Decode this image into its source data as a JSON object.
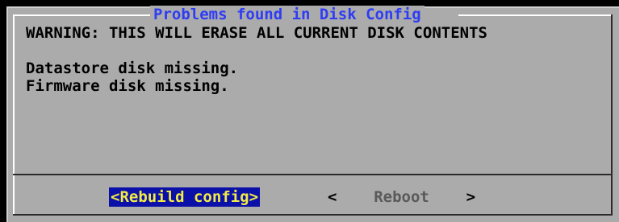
{
  "dialog": {
    "title": "Problems found in Disk Config",
    "warning": "WARNING: THIS WILL ERASE ALL CURRENT DISK CONTENTS",
    "messages": [
      "Datastore disk missing.",
      "Firmware disk missing."
    ]
  },
  "buttons": {
    "primary": "<Rebuild config>",
    "secondary_left_bracket": "<",
    "secondary_label": "Reboot",
    "secondary_right_bracket": ">"
  },
  "colors": {
    "dialog_background": "#ababab",
    "title_text": "#2e3cf4",
    "selected_button_background": "#0a10a8",
    "selected_button_text": "#f2ea45",
    "inactive_button_text": "#5a5a5a"
  }
}
